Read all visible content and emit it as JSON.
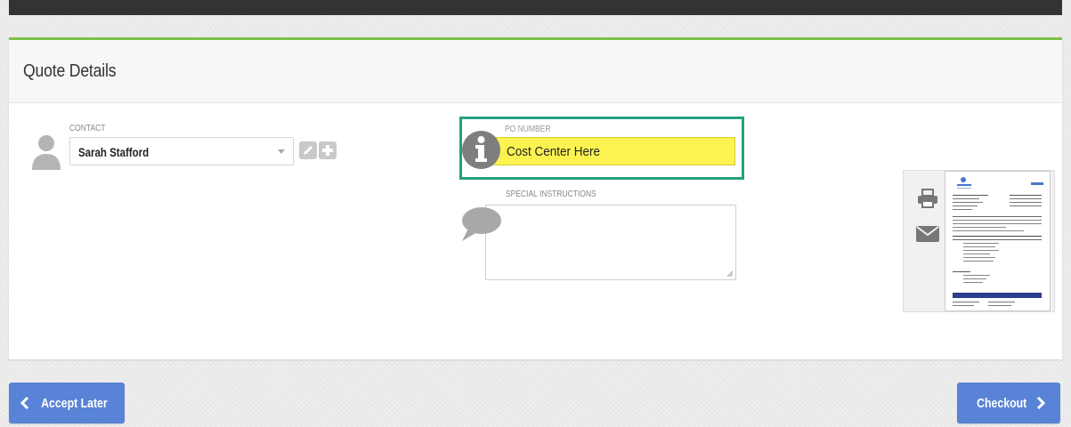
{
  "panel": {
    "title": "Quote Details"
  },
  "contact": {
    "label": "CONTACT",
    "value": "Sarah Stafford"
  },
  "po_number": {
    "label": "PO NUMBER",
    "value": "Cost Center Here"
  },
  "special_instructions": {
    "label": "SPECIAL INSTRUCTIONS",
    "value": ""
  },
  "footer": {
    "accept_later_label": "Accept Later",
    "checkout_label": "Checkout"
  },
  "colors": {
    "accent_green": "#7cc04b",
    "highlight_teal": "#26a07e",
    "po_field_yellow": "#fdf350",
    "button_blue": "#5983d6"
  },
  "icons": [
    "person-icon",
    "pencil-icon",
    "plus-icon",
    "info-icon",
    "speech-bubble-icon",
    "print-icon",
    "envelope-icon",
    "chevron-left-icon",
    "chevron-right-icon"
  ]
}
